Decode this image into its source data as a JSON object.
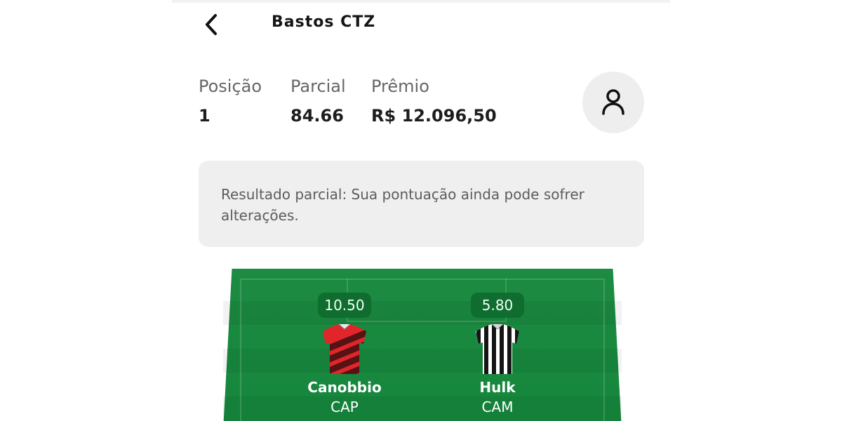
{
  "header": {
    "title": "Bastos CTZ",
    "icons": {
      "back": "chevron-left-icon",
      "profile": "user-icon"
    }
  },
  "stats": [
    {
      "label": "Posição",
      "value": "1"
    },
    {
      "label": "Parcial",
      "value": "84.66"
    },
    {
      "label": "Prêmio",
      "value": "R$ 12.096,50"
    }
  ],
  "notice": {
    "text": "Resultado parcial: Sua pontuação ainda pode sofrer alterações."
  },
  "players": [
    {
      "score": "10.50",
      "name": "Canobbio",
      "team": "CAP",
      "jersey_icon": "red-black-striped-jersey-icon"
    },
    {
      "score": "5.80",
      "name": "Hulk",
      "team": "CAM",
      "jersey_icon": "black-white-striped-jersey-icon"
    }
  ],
  "colors": {
    "field": "#1d8b42",
    "score_badge": "#0f6d2f",
    "notice_bg": "#efefef",
    "profile_bg": "#eeeeee"
  }
}
